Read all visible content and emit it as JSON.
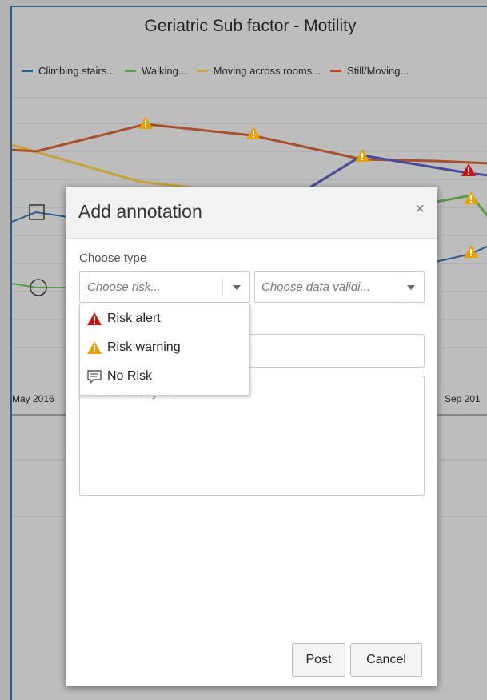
{
  "chart": {
    "title": "Geriatric Sub factor - Motility",
    "legend": [
      {
        "label": "Climbing stairs...",
        "color": "#2f5d8a"
      },
      {
        "label": "Walking...",
        "color": "#5a9a4a"
      },
      {
        "label": "Moving across rooms...",
        "color": "#c7a23a"
      },
      {
        "label": "Still/Moving...",
        "color": "#b24a2a"
      }
    ],
    "x_labels": [
      "May 2016",
      "Sep 201"
    ],
    "colors": {
      "climbing": "#4b4a9a",
      "walking": "#5a9a4a",
      "moving": "#c7a23a",
      "still": "#a8502e",
      "warning": "#e6a100",
      "alert": "#cc1111"
    }
  },
  "dialog": {
    "title": "Add annotation",
    "close_label": "×",
    "type_label": "Choose type",
    "risk_placeholder": "Choose risk...",
    "validity_placeholder": "Choose data validi...",
    "comment_placeholder": "No comment yet.",
    "risk_options": [
      {
        "label": "Risk alert",
        "icon": "risk-alert-icon"
      },
      {
        "label": "Risk warning",
        "icon": "risk-warning-icon"
      },
      {
        "label": "No Risk",
        "icon": "comment-icon"
      }
    ],
    "post_label": "Post",
    "cancel_label": "Cancel"
  }
}
